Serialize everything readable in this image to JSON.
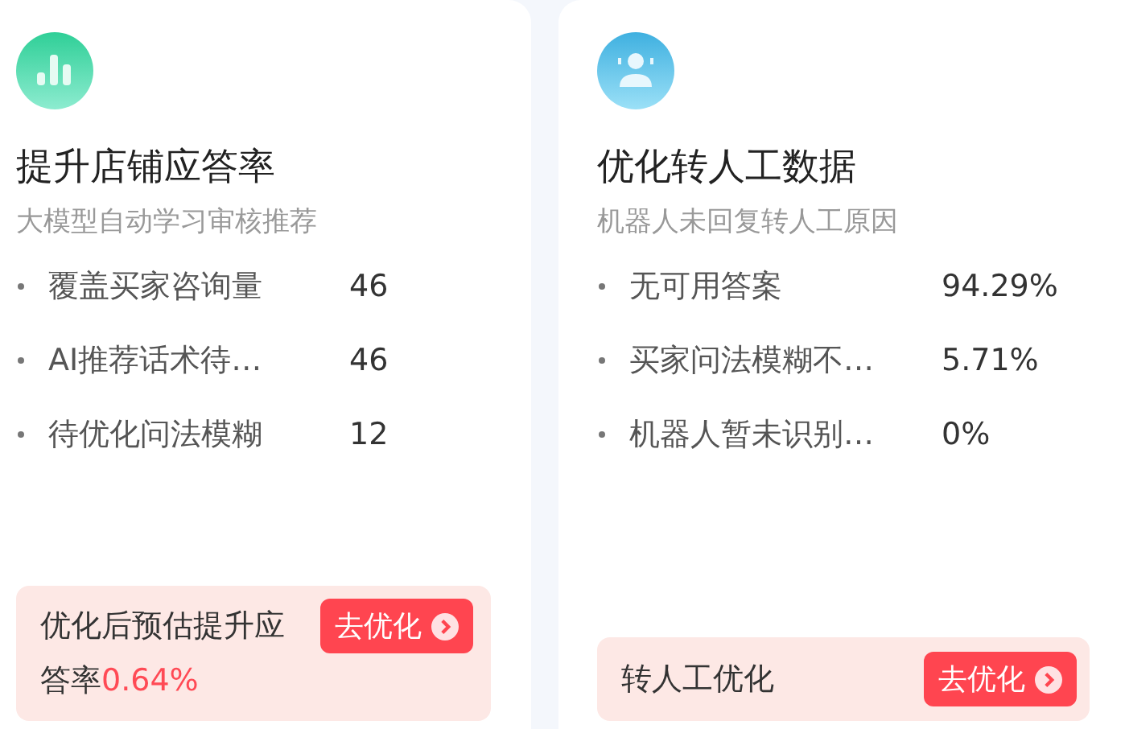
{
  "cards": [
    {
      "kind": "chart",
      "title": "提升店铺应答率",
      "subtitle": "大模型自动学习审核推荐",
      "metrics": [
        {
          "label": "覆盖买家咨询量",
          "value": "46"
        },
        {
          "label": "AI推荐话术待…",
          "value": "46"
        },
        {
          "label": "待优化问法模糊",
          "value": "12"
        }
      ],
      "footer": {
        "text": "优化后预估提升应答率",
        "value": "0.64%",
        "button": "去优化"
      }
    },
    {
      "kind": "agent",
      "title": "优化转人工数据",
      "subtitle": "机器人未回复转人工原因",
      "metrics": [
        {
          "label": "无可用答案",
          "value": "94.29%"
        },
        {
          "label": "买家问法模糊不…",
          "value": "5.71%"
        },
        {
          "label": "机器人暂未识别…",
          "value": "0%"
        }
      ],
      "footer": {
        "text": "转人工优化",
        "button": "去优化"
      }
    }
  ]
}
